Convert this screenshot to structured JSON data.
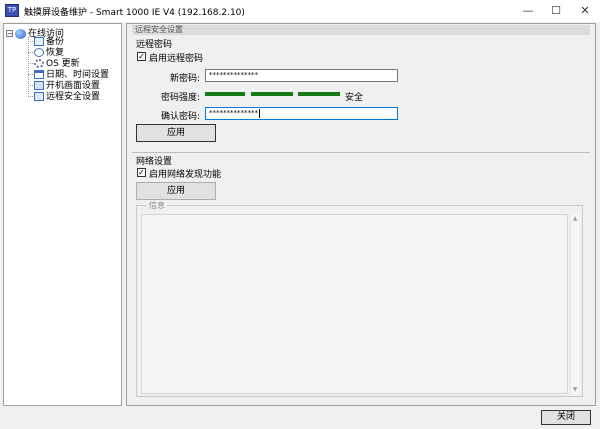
{
  "window": {
    "title": "触摸屏设备维护 - Smart 1000 IE V4 (192.168.2.10)",
    "app_icon": "tp-device-icon",
    "controls": {
      "minimize": "—",
      "maximize": "☐",
      "close": "✕"
    }
  },
  "tree": {
    "root_label": "在线访问",
    "items": [
      {
        "label": "备份",
        "icon": "backup-icon"
      },
      {
        "label": "恢复",
        "icon": "restore-icon"
      },
      {
        "label": "OS 更新",
        "icon": "os-update-icon"
      },
      {
        "label": "日期、时间设置",
        "icon": "calendar-icon"
      },
      {
        "label": "开机画面设置",
        "icon": "splash-screen-icon"
      },
      {
        "label": "远程安全设置",
        "icon": "monitor-icon"
      }
    ]
  },
  "main": {
    "section_title": "远程安全设置",
    "remote_password": {
      "group_title": "远程密码",
      "enable_label": "启用远程密码",
      "enable_checked": true,
      "new_password_label": "新密码:",
      "new_password_value": "**************",
      "strength_label": "密码强度:",
      "strength_text": "安全",
      "strength_color": "#157b15",
      "confirm_label": "确认密码:",
      "confirm_value": "**************",
      "apply_label": "应用"
    },
    "network": {
      "group_title": "网络设置",
      "discovery_label": "启用网络发现功能",
      "discovery_checked": true,
      "apply_label": "应用"
    },
    "info": {
      "legend": "信息",
      "text": ""
    }
  },
  "footer": {
    "close_label": "关闭"
  }
}
